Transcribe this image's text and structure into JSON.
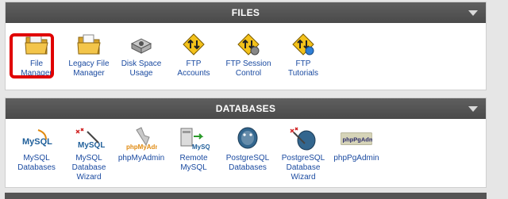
{
  "files": {
    "header": "FILES",
    "items": [
      {
        "label": "File\nManager",
        "icon": "file-manager-icon"
      },
      {
        "label": "Legacy File\nManager",
        "icon": "legacy-file-manager-icon"
      },
      {
        "label": "Disk Space\nUsage",
        "icon": "disk-space-icon"
      },
      {
        "label": "FTP\nAccounts",
        "icon": "ftp-accounts-icon"
      },
      {
        "label": "FTP Session\nControl",
        "icon": "ftp-session-icon"
      },
      {
        "label": "FTP\nTutorials",
        "icon": "ftp-tutorials-icon"
      }
    ]
  },
  "databases": {
    "header": "DATABASES",
    "items": [
      {
        "label": "MySQL\nDatabases",
        "icon": "mysql-databases-icon",
        "logo_text": "MySQL"
      },
      {
        "label": "MySQL\nDatabase\nWizard",
        "icon": "mysql-wizard-icon",
        "logo_text": "MySQL"
      },
      {
        "label": "phpMyAdmin",
        "icon": "phpmyadmin-icon",
        "logo_text": "phpMyAdmin"
      },
      {
        "label": "Remote\nMySQL",
        "icon": "remote-mysql-icon",
        "logo_text": "MySQL"
      },
      {
        "label": "PostgreSQL\nDatabases",
        "icon": "postgresql-databases-icon"
      },
      {
        "label": "PostgreSQL\nDatabase\nWizard",
        "icon": "postgresql-wizard-icon"
      },
      {
        "label": "phpPgAdmin",
        "icon": "phppgadmin-icon",
        "logo_text": "phpPgAdmin"
      }
    ]
  },
  "colors": {
    "header_bg": "#4f4f4f",
    "link": "#1a4aa0",
    "highlight": "#e00000"
  }
}
